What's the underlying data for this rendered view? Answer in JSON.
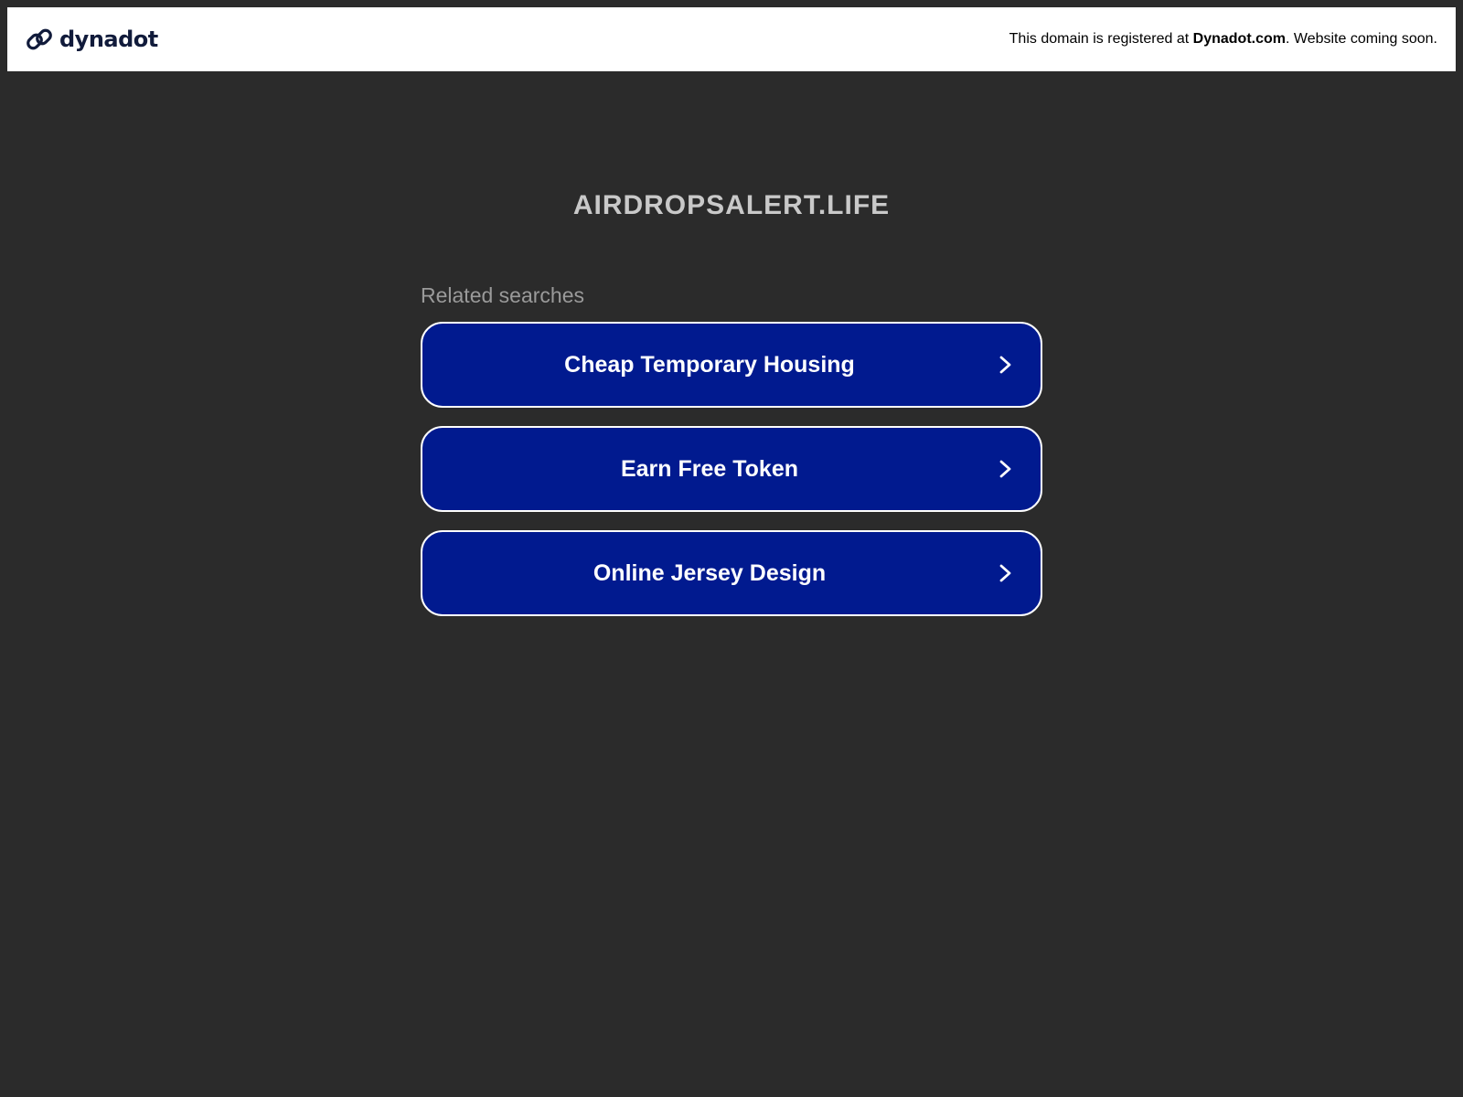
{
  "header": {
    "brand_name": "dynadot",
    "brand_icon": "chain-link-icon",
    "notice_prefix": "This domain is registered at ",
    "notice_brand": "Dynadot.com",
    "notice_suffix": ". Website coming soon."
  },
  "main": {
    "domain": "AIRDROPSALERT.LIFE",
    "related_label": "Related searches",
    "searches": [
      {
        "label": "Cheap Temporary Housing",
        "icon": "chevron-right-icon"
      },
      {
        "label": "Earn Free Token",
        "icon": "chevron-right-icon"
      },
      {
        "label": "Online Jersey Design",
        "icon": "chevron-right-icon"
      }
    ]
  },
  "colors": {
    "background": "#2b2b2b",
    "header_bg": "#ffffff",
    "button_bg": "#011a8f",
    "button_border": "#ffffff",
    "title_text": "#c9c9c9",
    "label_text": "#9a9a9a",
    "brand_text": "#111b3b"
  }
}
